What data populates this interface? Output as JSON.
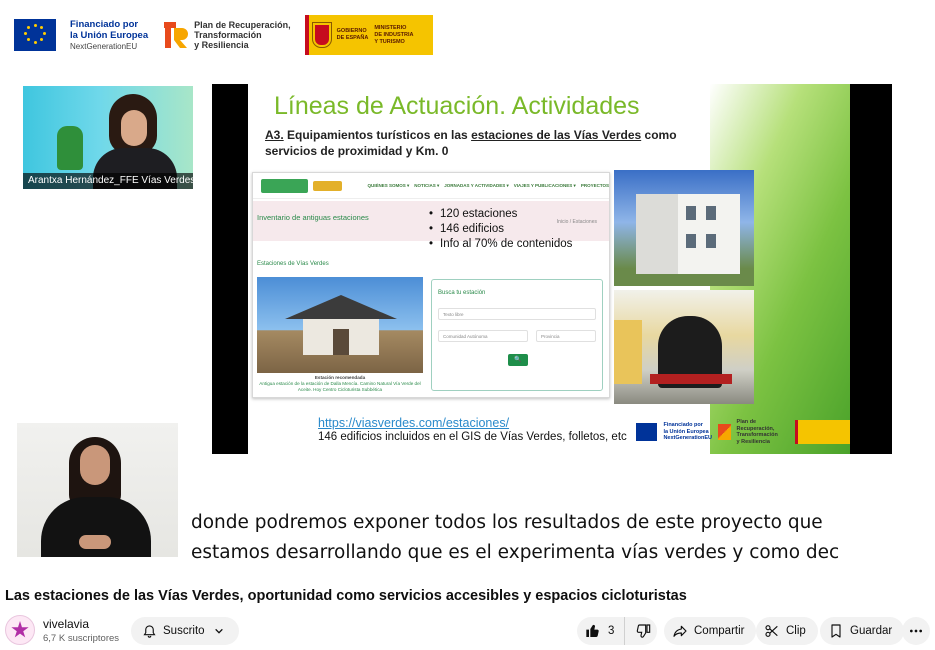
{
  "funding_banner": {
    "eu_line1": "Financiado por",
    "eu_line2": "la Unión Europea",
    "eu_line3": "NextGenerationEU",
    "prtr_line1": "Plan de Recuperación,",
    "prtr_line2": "Transformación",
    "prtr_line3": "y Resiliencia",
    "gob_line1": "GOBIERNO",
    "gob_line2": "DE ESPAÑA",
    "gob_line3": "MINISTERIO",
    "gob_line4": "DE INDUSTRIA",
    "gob_line5": "Y TURISMO"
  },
  "speaker": {
    "name": "Arantxa Hernández_FFE Vías Verdes"
  },
  "slide": {
    "title": "Líneas de Actuación. Actividades",
    "subtitle_prefix": "A3.",
    "subtitle_part1": " Equipamientos turísticos en las ",
    "subtitle_link": "estaciones de las Vías Verdes",
    "subtitle_part2": " como servicios de proximidad y Km. 0",
    "bullets": [
      "120 estaciones",
      "146 edificios",
      "Info al 70% de contenidos"
    ],
    "website": {
      "nav_items": [
        "QUIÉNES SOMOS ▾",
        "NOTICIAS ▾",
        "JORNADAS Y ACTIVIDADES ▾",
        "VIAJES Y PUBLICACIONES ▾",
        "PROYECTOS"
      ],
      "band_title": "Inventario de antiguas estaciones",
      "breadcrumb": "Inicio  /  Estaciones",
      "section_title": "Estaciones de Vías Verdes",
      "caption_line1": "Estación recomendada",
      "caption_line2": "Antigua estación de la estación de Dalla Mencía. Camino Natural Vía Verde del",
      "caption_line3": "Aceite. Hoy Centro Cicloturista Subbética",
      "form_title": "Busca tu estación",
      "field_text": "Texto libre",
      "field_ccaa": "Comunidad Autónoma",
      "field_prov": "Provincia"
    },
    "link": "https://viasverdes.com/estaciones/",
    "footer": "146 edificios incluidos en el GIS de Vías Verdes, folletos, etc",
    "logo_eu1": "Financiado por",
    "logo_eu2": "la Unión Europea",
    "logo_eu3": "NextGenerationEU",
    "logo_prtr1": "Plan de Recuperación,",
    "logo_prtr2": "Transformación",
    "logo_prtr3": "y Resiliencia"
  },
  "caption": {
    "line1": "donde podremos exponer todos los resultados de este proyecto que",
    "line2": "estamos desarrollando que es el experimenta vías verdes y como dec"
  },
  "video": {
    "title": "Las estaciones de las Vías Verdes, oportunidad como servicios accesibles y espacios cicloturistas"
  },
  "channel": {
    "name": "vivelavia",
    "subscribers": "6,7 K suscriptores",
    "subscribe_label": "Suscrito"
  },
  "actions": {
    "like_count": "3",
    "share_label": "Compartir",
    "clip_label": "Clip",
    "save_label": "Guardar"
  },
  "colors": {
    "slide_title": "#7ab929",
    "link": "#2a8acb",
    "eu_blue": "#003399",
    "gob_yellow": "#f5c400"
  },
  "icons": {
    "subscribe": "bell-icon",
    "like": "thumbs-up-icon",
    "dislike": "thumbs-down-icon",
    "share": "share-arrow-icon",
    "clip": "scissors-icon",
    "save": "bookmark-icon",
    "more": "more-horizontal-icon"
  }
}
